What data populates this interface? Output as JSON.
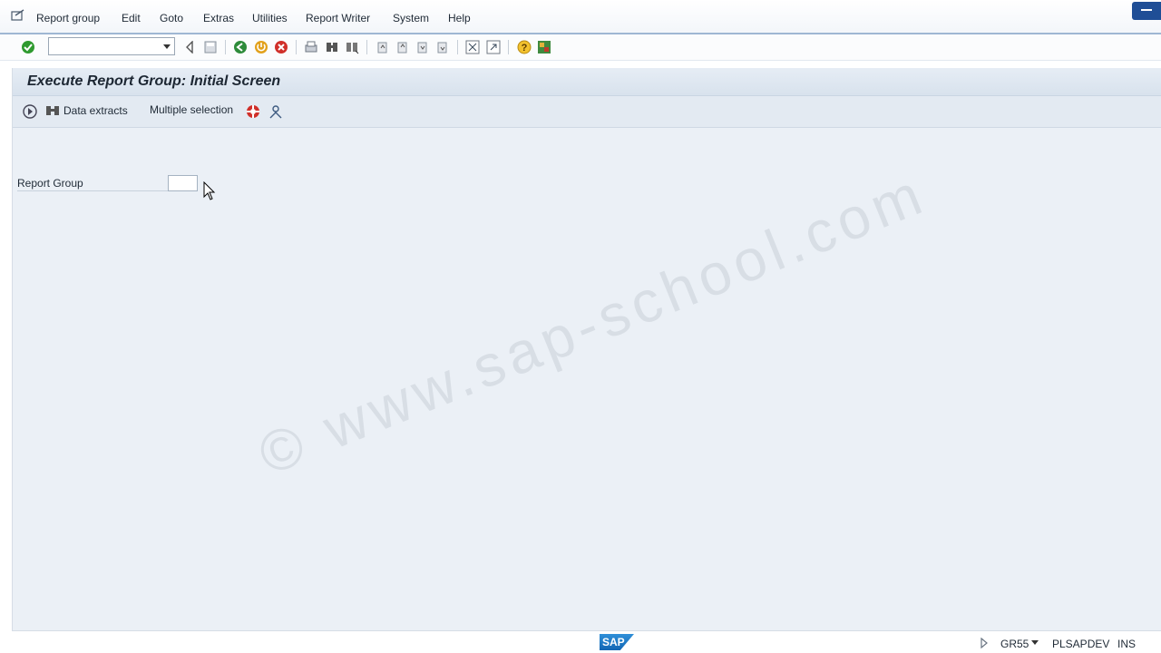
{
  "menu": {
    "items": [
      "Report group",
      "Edit",
      "Goto",
      "Extras",
      "Utilities",
      "Report Writer",
      "System",
      "Help"
    ]
  },
  "toolbar": {
    "command_value": "",
    "icons": [
      "enter-icon",
      "back-icon",
      "save-icon",
      "back-green-icon",
      "exit-icon",
      "cancel-icon",
      "print-icon",
      "find-icon",
      "find-next-icon",
      "first-page-icon",
      "previous-page-icon",
      "next-page-icon",
      "last-page-icon",
      "create-session-icon",
      "shortcut-icon",
      "help-icon",
      "customize-layout-icon"
    ]
  },
  "page": {
    "title": "Execute Report Group: Initial Screen"
  },
  "app_toolbar": {
    "data_extracts_label": "Data extracts",
    "multiple_selection_label": "Multiple selection"
  },
  "form": {
    "report_group_label": "Report Group",
    "report_group_value": ""
  },
  "watermark": {
    "text": "© www.sap-school.com"
  },
  "status": {
    "logo_text": "SAP",
    "transaction": "GR55",
    "system": "PLSAPDEV",
    "mode": "INS"
  },
  "colors": {
    "accent": "#1f4e96",
    "background": "#ebf0f6",
    "title_bar": "#dce5ef"
  }
}
